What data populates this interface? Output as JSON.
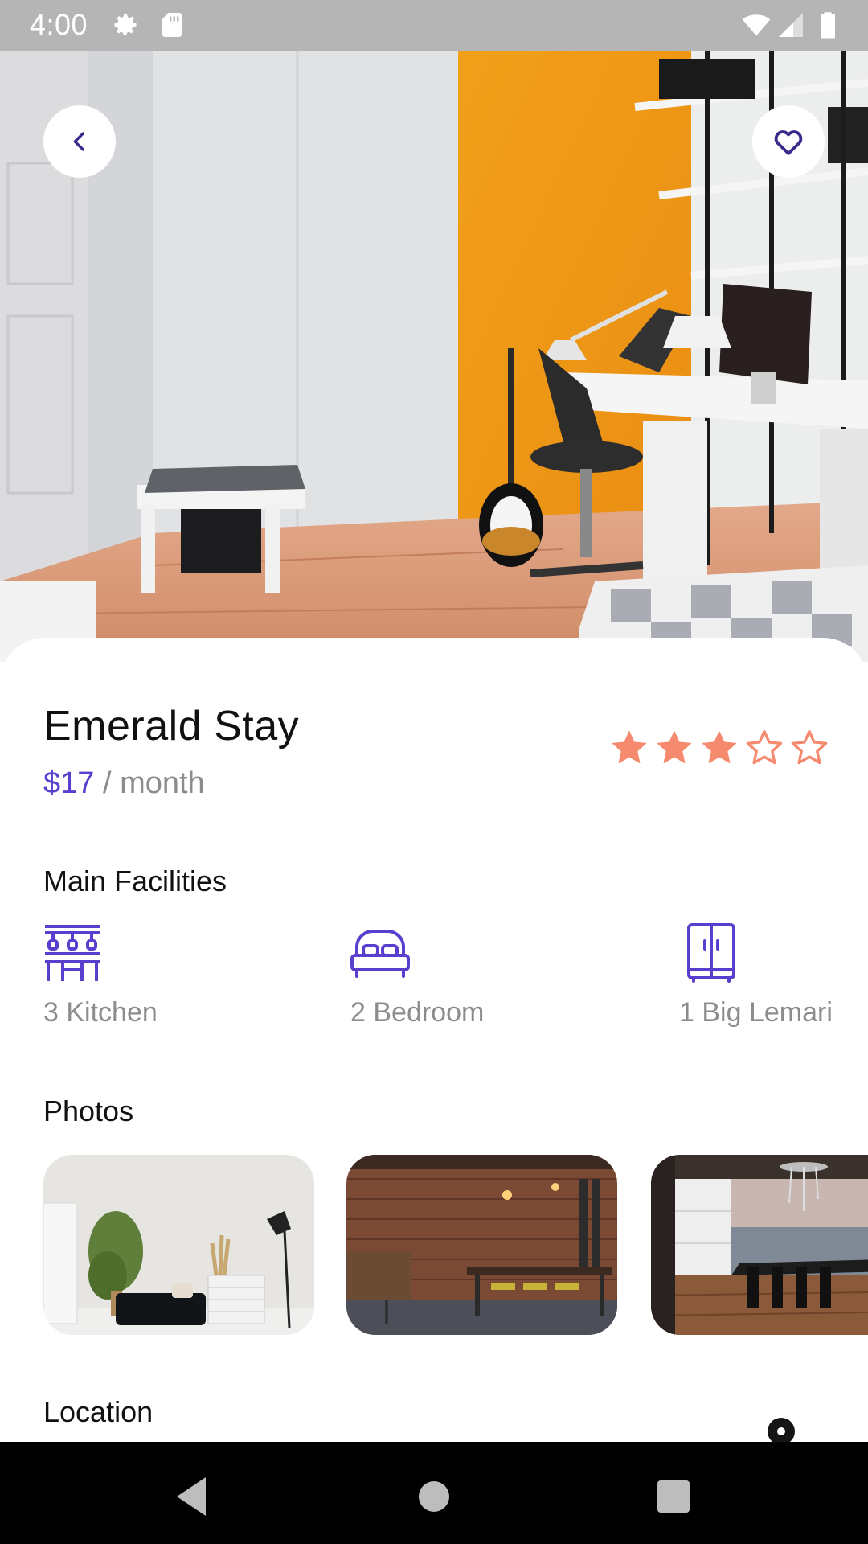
{
  "status_bar": {
    "time": "4:00",
    "icons": [
      "gear-icon",
      "sd-card-icon",
      "wifi-icon",
      "signal-icon",
      "battery-icon"
    ]
  },
  "hero": {
    "image": "room-with-orange-wall-photo",
    "back_icon": "chevron-left-icon",
    "favorite_icon": "heart-outline-icon"
  },
  "listing": {
    "title": "Emerald Stay",
    "price": "$17",
    "price_suffix": " / month",
    "rating": 3,
    "rating_max": 5
  },
  "facilities": {
    "heading": "Main Facilities",
    "items": [
      {
        "label": "3 Kitchen",
        "icon": "kitchen-icon"
      },
      {
        "label": "2 Bedroom",
        "icon": "bed-icon"
      },
      {
        "label": "1 Big Lemari",
        "icon": "wardrobe-icon"
      }
    ]
  },
  "photos": {
    "heading": "Photos",
    "items": [
      "living-room-photo",
      "brick-dining-room-photo",
      "seaside-dining-room-photo"
    ]
  },
  "location": {
    "heading": "Location"
  },
  "colors": {
    "accent": "#5a3fcf",
    "star": "#f58a6e",
    "muted_text": "#8c8c8c"
  }
}
